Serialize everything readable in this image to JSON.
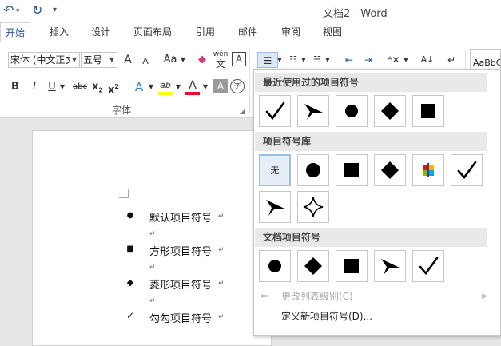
{
  "titlebar": {
    "title": "文档2 - Word",
    "undo_icon": "undo-icon",
    "redo_icon": "redo-icon",
    "customize_icon": "customize-quick-access-icon"
  },
  "tabs": [
    {
      "label": "开始",
      "active": true
    },
    {
      "label": "插入"
    },
    {
      "label": "设计"
    },
    {
      "label": "页面布局"
    },
    {
      "label": "引用"
    },
    {
      "label": "邮件"
    },
    {
      "label": "审阅"
    },
    {
      "label": "视图"
    }
  ],
  "ribbon": {
    "font_name": "宋体 (中文正文",
    "font_size": "五号",
    "grow_font": "A",
    "shrink_font": "A",
    "change_case": "Aa",
    "phonetic_top": "wén",
    "phonetic_bottom": "文",
    "bold": "B",
    "italic": "I",
    "underline": "U",
    "strikethrough": "abc",
    "subscript": "x",
    "subscript_mark": "2",
    "superscript": "x",
    "superscript_mark": "2",
    "text_effects": "A",
    "highlight": "ab",
    "font_color": "A",
    "char_shading": "A",
    "enclose_char": "字",
    "group_label": "字体",
    "styles_preview": "AaBbC",
    "highlight_color": "#ffff00",
    "font_color_value": "#e81123"
  },
  "bullet_menu": {
    "recent_title": "最近使用过的项目符号",
    "library_title": "项目符号库",
    "document_title": "文档项目符号",
    "recent": [
      "check",
      "arrowhead",
      "circle",
      "diamond",
      "square"
    ],
    "library": [
      "none",
      "circle",
      "square",
      "diamond",
      "multicolor",
      "check",
      "arrowhead",
      "star4"
    ],
    "none_label": "无",
    "document": [
      "circle",
      "diamond",
      "square",
      "arrowhead",
      "check"
    ],
    "change_level_label": "更改列表级别(C)",
    "define_new_label": "定义新项目符号(D)..."
  },
  "document": {
    "items": [
      {
        "symbol": "●",
        "text": "默认项目符号"
      },
      {
        "symbol": "■",
        "text": "方形项目符号"
      },
      {
        "symbol": "◆",
        "text": "菱形项目符号"
      },
      {
        "symbol": "✓",
        "text": "勾勾项目符号"
      }
    ],
    "para_mark": "↵"
  }
}
